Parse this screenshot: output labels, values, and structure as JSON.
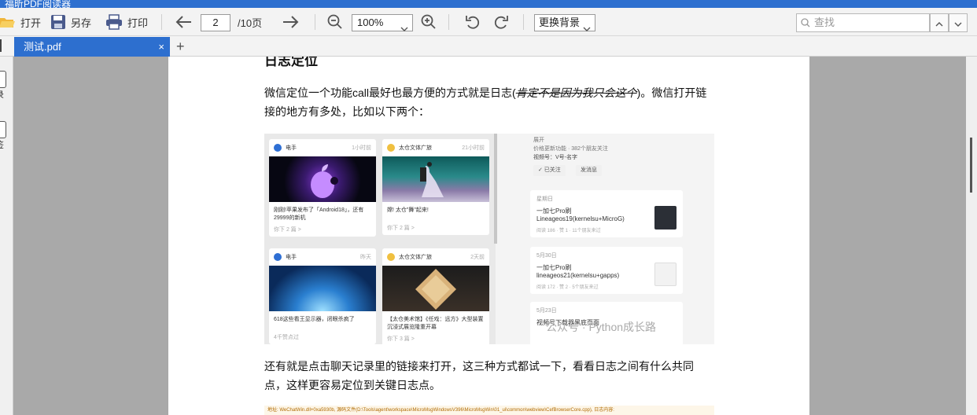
{
  "window": {
    "title": "福昕PDF阅读器"
  },
  "toolbar": {
    "open_label": "打开",
    "saveas_label": "另存",
    "print_label": "打印",
    "page_current": "2",
    "page_total": "/10页",
    "zoom_value": "100%",
    "background_label": "更换背景",
    "search_placeholder": "查找"
  },
  "tabs": [
    {
      "label": "测试.pdf",
      "close": "×"
    }
  ],
  "tab_add": "+",
  "leftpanel": {
    "items": [
      {
        "label": "录"
      },
      {
        "label": "签"
      }
    ]
  },
  "document": {
    "heading": "日志定位",
    "para1_before": "微信定位一个功能call最好也最方便的方式就是日志(",
    "para1_strike": "肯定不是因为我只会这个",
    "para1_after": ")。微信打开链接的地方有多处，比如以下两个：",
    "para2": "还有就是点击聊天记录里的链接来打开，这三种方式都试一下，看看日志之间有什么共同点，这样更容易定位到关键日志点。",
    "codeline": "地址: WeChatWin.dll+0xa5930b, 源码文件(D:\\Tools\\agent\\workspace\\MicroMsgWindowsV396\\MicroMsgWin\\01_ui\\common\\webview\\CefBrowserCore.cpp), 日志内容:"
  },
  "screenshot": {
    "feed_cards": [
      {
        "source": "电手",
        "time": "1小时前",
        "title": "刚刚!苹果发布了「Android18」，还有29999的新机",
        "footer": "你下 2 篇 >"
      },
      {
        "source": "太仓文体广旅",
        "time": "21小时前",
        "title": "嫦! 太仓\"舞\"起来!",
        "footer": "你下 2 篇 >"
      },
      {
        "source": "电手",
        "time": "昨天",
        "title": "618这些看王显示器，闭眼杀疯了",
        "footer": "4千赞点过"
      },
      {
        "source": "太仓文体广旅",
        "time": "2天前",
        "title": "【太仓美术馆】《任戏：远方》大型装置沉浸式展览隆重开幕",
        "footer": "你下 3 篇 >"
      }
    ],
    "profile": {
      "line1": "展开",
      "line2": "价格更新功能 · 382个朋友关注",
      "line3": "视频号：V号-名字",
      "followed": "✓ 已关注",
      "message": "发消息"
    },
    "articles": [
      {
        "date": "星期日",
        "title": "一加七Pro刷Lineageos19(kernelsu+MicroG)",
        "meta": "阅读 186 · 赞 1 · 11个朋友来过"
      },
      {
        "date": "5月30日",
        "title": "一加七Pro刷lineageos21(kernelsu+gapps)",
        "meta": "阅读 172 · 赞 2 · 5个朋友来过"
      },
      {
        "date": "5月23日",
        "title": "视频号下载器黑底页面",
        "meta": ""
      }
    ],
    "watermark": "公众号 · Python成长路"
  }
}
